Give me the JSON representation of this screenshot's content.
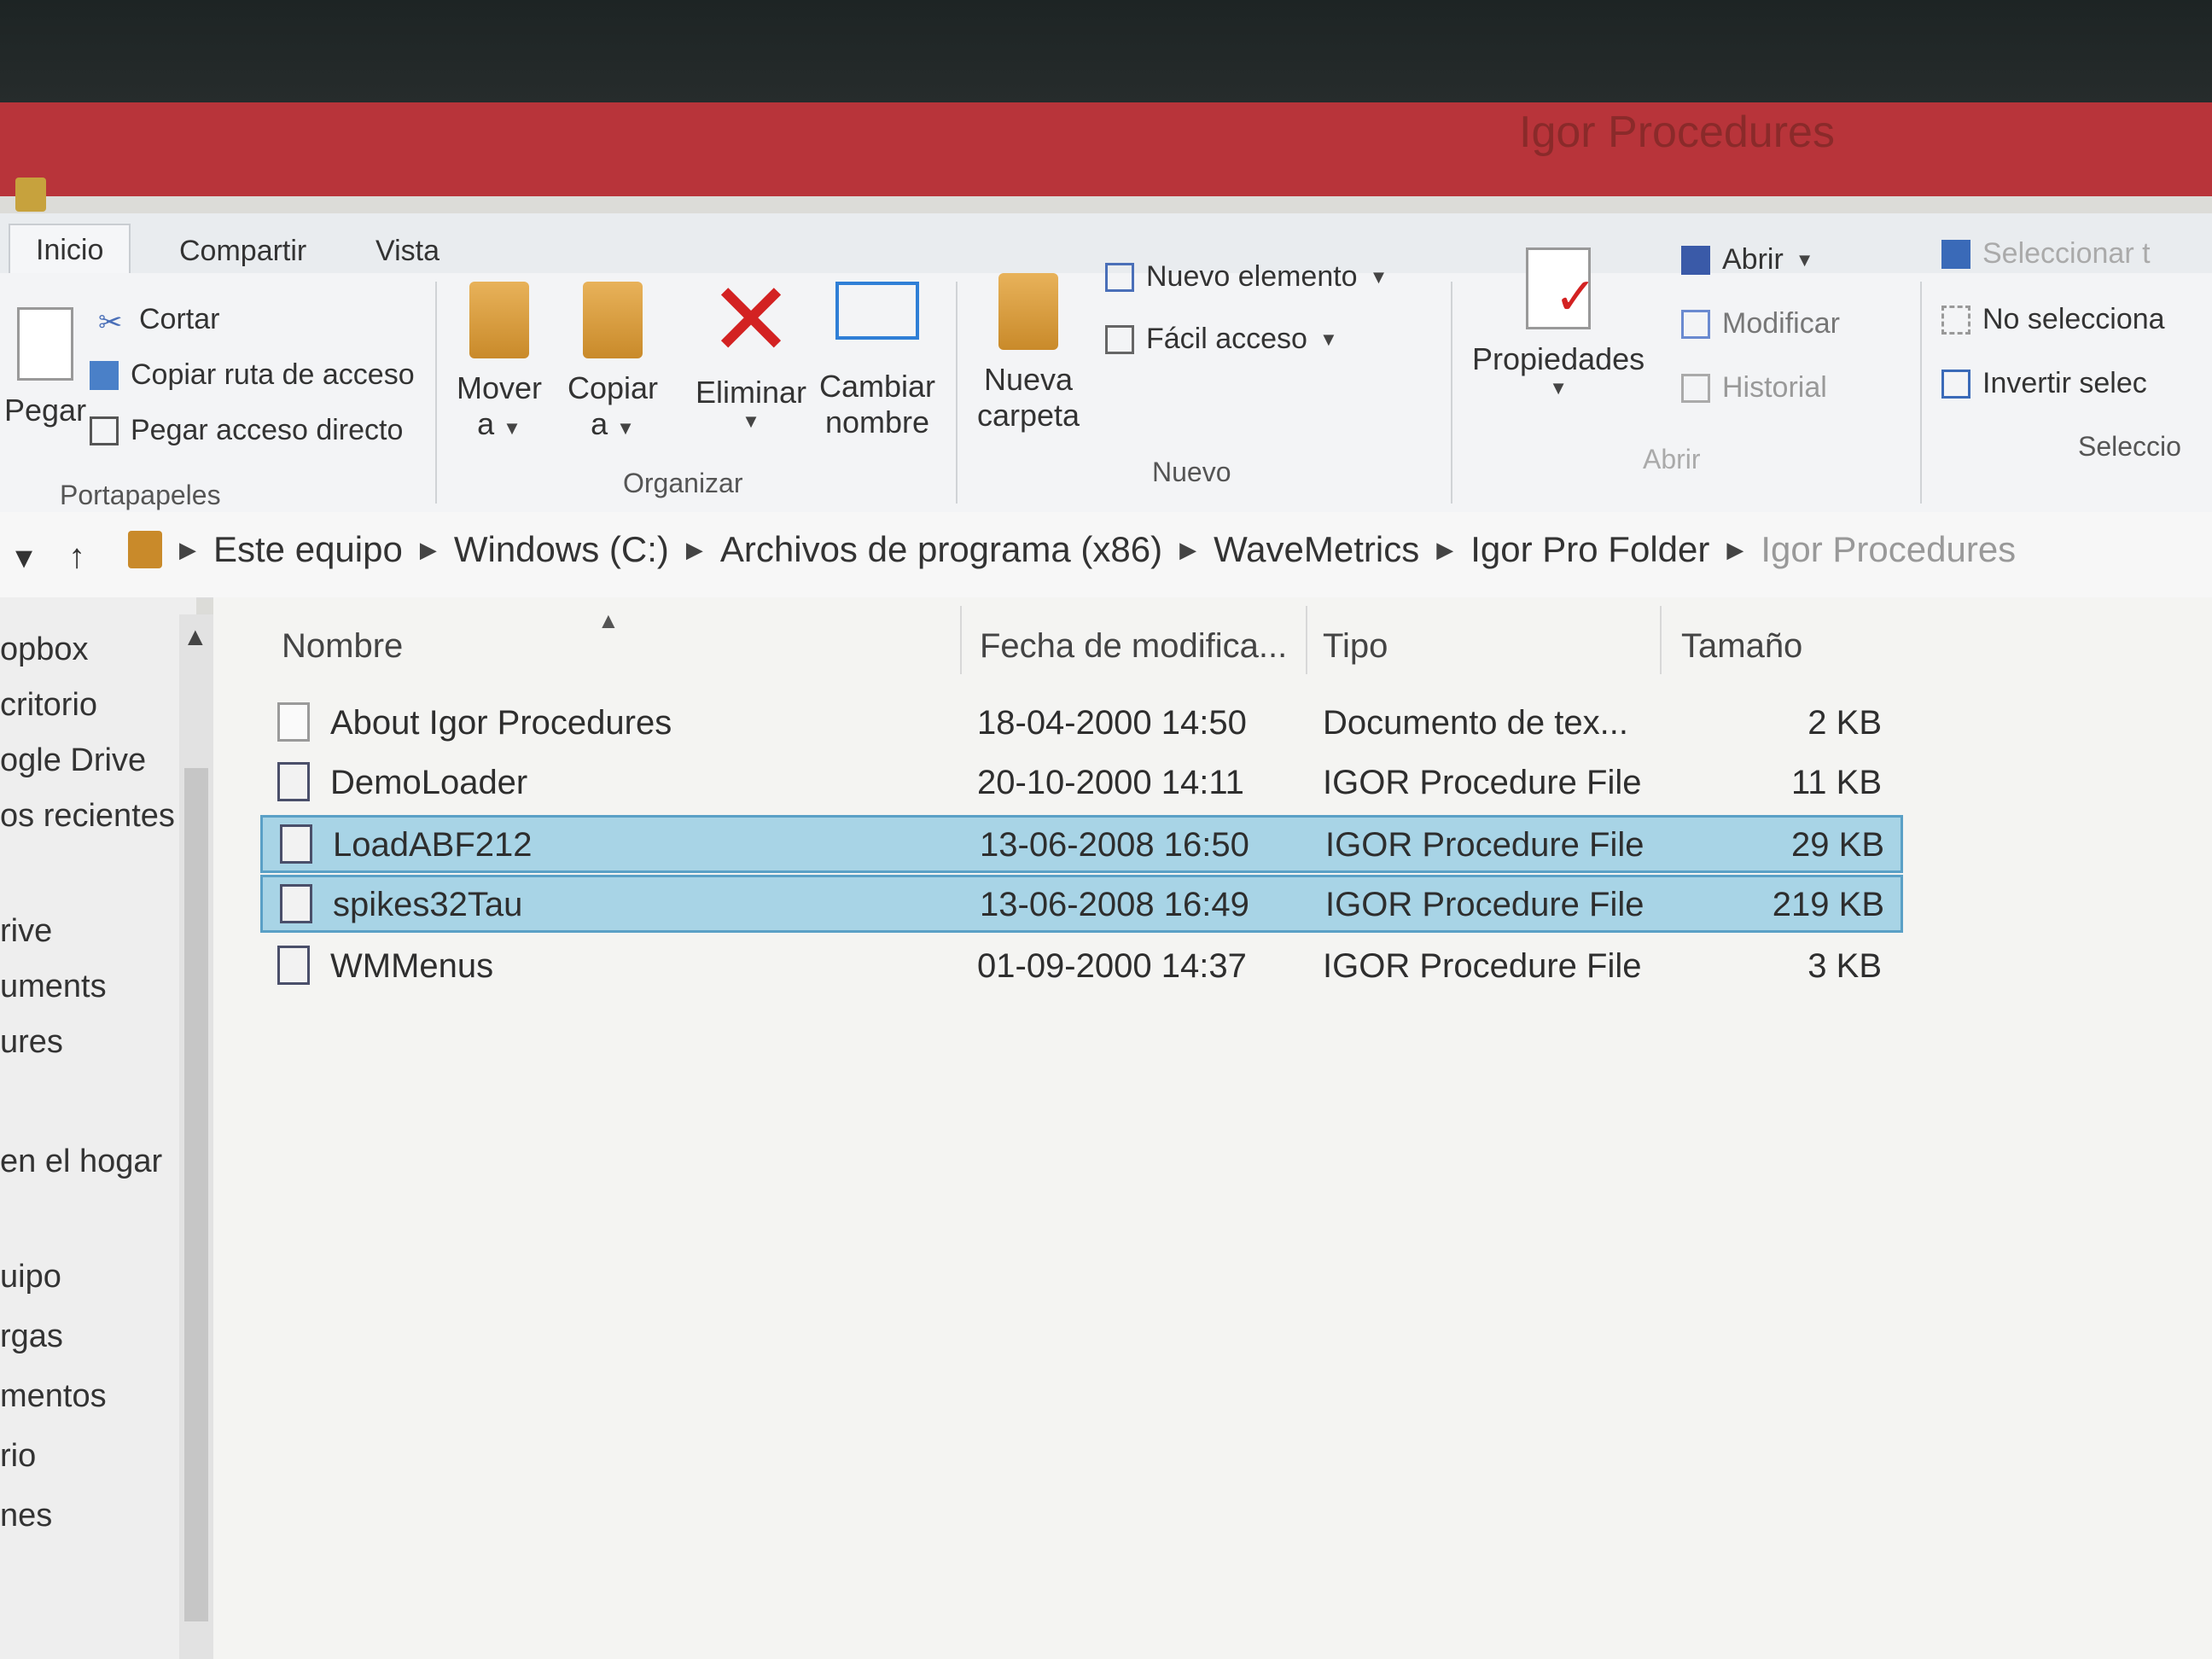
{
  "window": {
    "title": "Igor Procedures"
  },
  "tabs": [
    {
      "label": "Inicio",
      "active": true
    },
    {
      "label": "Compartir",
      "active": false
    },
    {
      "label": "Vista",
      "active": false
    }
  ],
  "ribbon": {
    "portapapeles": {
      "label": "Portapapeles",
      "pegar": "Pegar",
      "cortar": "Cortar",
      "copiar_ruta": "Copiar ruta de acceso",
      "pegar_acceso": "Pegar acceso directo"
    },
    "organizar": {
      "label": "Organizar",
      "mover_1": "Mover",
      "mover_2": "a",
      "copiar_1": "Copiar",
      "copiar_2": "a",
      "eliminar": "Eliminar",
      "cambiar_1": "Cambiar",
      "cambiar_2": "nombre"
    },
    "nuevo": {
      "label": "Nuevo",
      "nueva_1": "Nueva",
      "nueva_2": "carpeta",
      "nuevo_elemento": "Nuevo elemento",
      "facil_acceso": "Fácil acceso"
    },
    "abrir": {
      "label": "Abrir",
      "propiedades": "Propiedades",
      "abrir": "Abrir",
      "modificar": "Modificar",
      "historial": "Historial"
    },
    "seleccionar": {
      "label": "Seleccio",
      "seleccionar_todo": "Seleccionar t",
      "no_seleccionar": "No selecciona",
      "invertir": "Invertir selec"
    }
  },
  "address": {
    "crumbs": [
      "Este equipo",
      "Windows (C:)",
      "Archivos de programa (x86)",
      "WaveMetrics",
      "Igor Pro Folder",
      "Igor Procedures"
    ]
  },
  "navpane": {
    "items": [
      "opbox",
      "critorio",
      "ogle Drive",
      "os recientes",
      "rive",
      "uments",
      "ures",
      "en el hogar",
      "uipo",
      "rgas",
      "mentos",
      "rio",
      "nes"
    ]
  },
  "columns": {
    "nombre": "Nombre",
    "fecha": "Fecha de modifica...",
    "tipo": "Tipo",
    "tamano": "Tamaño"
  },
  "files": [
    {
      "name": "About Igor Procedures",
      "date": "18-04-2000 14:50",
      "type": "Documento de tex...",
      "size": "2 KB",
      "selected": false
    },
    {
      "name": "DemoLoader",
      "date": "20-10-2000 14:11",
      "type": "IGOR Procedure File",
      "size": "11 KB",
      "selected": false
    },
    {
      "name": "LoadABF212",
      "date": "13-06-2008 16:50",
      "type": "IGOR Procedure File",
      "size": "29 KB",
      "selected": true
    },
    {
      "name": "spikes32Tau",
      "date": "13-06-2008 16:49",
      "type": "IGOR Procedure File",
      "size": "219 KB",
      "selected": true
    },
    {
      "name": "WMMenus",
      "date": "01-09-2000 14:37",
      "type": "IGOR Procedure File",
      "size": "3 KB",
      "selected": false
    }
  ]
}
